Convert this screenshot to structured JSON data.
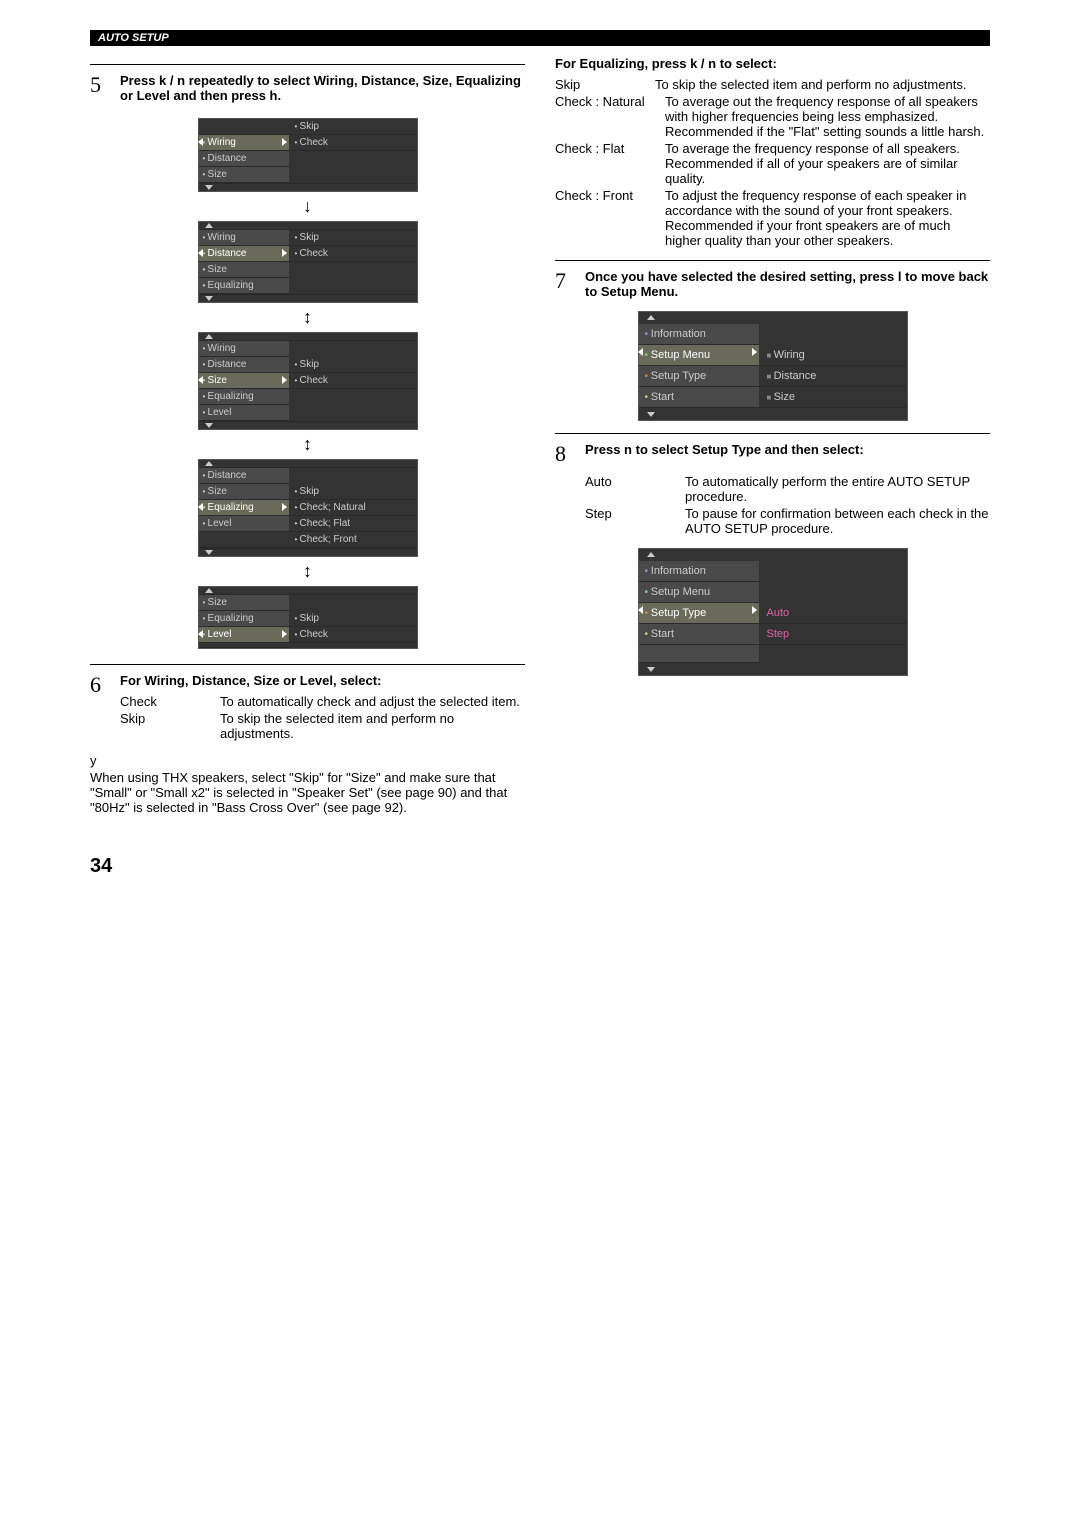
{
  "header": "AUTO SETUP",
  "pageNumber": "34",
  "step5": {
    "num": "5",
    "text_a": "Press ",
    "text_b": " / ",
    "text_c": " repeatedly to select Wiring, Distance, Size, Equalizing or Level and then press ",
    "k": "k",
    "n": "n",
    "h": "h",
    "l": "l",
    "dot": "."
  },
  "menus": {
    "m1": {
      "items": [
        "Wiring",
        "Distance",
        "Size"
      ],
      "sel": 0,
      "opts": [
        "Skip",
        "Check"
      ]
    },
    "m2": {
      "items": [
        "Wiring",
        "Distance",
        "Size",
        "Equalizing"
      ],
      "sel": 1,
      "opts": [
        "Skip",
        "Check"
      ]
    },
    "m3": {
      "items": [
        "Wiring",
        "Distance",
        "Size",
        "Equalizing",
        "Level"
      ],
      "sel": 2,
      "opts": [
        "Skip",
        "Check"
      ]
    },
    "m4": {
      "items": [
        "Distance",
        "Size",
        "Equalizing",
        "Level"
      ],
      "sel": 2,
      "opts": [
        "Skip",
        "Check; Natural",
        "Check; Flat",
        "Check; Front"
      ]
    },
    "m5": {
      "items": [
        "Size",
        "Equalizing",
        "Level"
      ],
      "sel": 2,
      "opts": [
        "Skip",
        "Check"
      ]
    }
  },
  "step6": {
    "num": "6",
    "heading": "For Wiring, Distance, Size or Level, select:",
    "rows": [
      {
        "term": "Check",
        "desc": "To automatically check and adjust the selected item."
      },
      {
        "term": "Skip",
        "desc": "To skip the selected item and perform no adjustments."
      }
    ],
    "noteSymbol": "y",
    "note": "When using THX speakers, select \"Skip\" for \"Size\" and make sure that \"Small\" or \"Small x2\" is selected in \"Speaker Set\" (see page 90) and that \"80Hz\" is selected in \"Bass Cross Over\" (see page 92)."
  },
  "eq": {
    "heading": "For Equalizing, press ",
    "heading_b": " / ",
    "heading_c": " to select:",
    "rows": [
      {
        "term": "Skip",
        "desc": "To skip the selected item and perform no adjustments."
      },
      {
        "term": "Check : Natural",
        "desc": "To average out the frequency response of all speakers with higher frequencies being less emphasized. Recommended if the \"Flat\" setting sounds a little harsh."
      },
      {
        "term": "Check : Flat",
        "desc": "To average the frequency response of all speakers. Recommended if all of your speakers are of similar quality."
      },
      {
        "term": "Check : Front",
        "desc": "To adjust the frequency response of each speaker in accordance with the sound of your front speakers. Recommended if your front speakers are of much higher quality than your other speakers."
      }
    ]
  },
  "step7": {
    "num": "7",
    "text": "Once you have selected the desired setting, press ",
    "text_b": " to move back to Setup Menu.",
    "menu": {
      "left": [
        "Information",
        "Setup Menu",
        "Setup Type",
        "Start"
      ],
      "sel": 1,
      "right": [
        "Wiring",
        "Distance",
        "Size"
      ]
    }
  },
  "step8": {
    "num": "8",
    "heading": "Press ",
    "heading_b": " to select Setup Type and then select:",
    "rows": [
      {
        "term": "Auto",
        "desc": "To automatically perform the entire AUTO SETUP procedure."
      },
      {
        "term": "Step",
        "desc": "To pause for confirmation between each check in the AUTO SETUP procedure."
      }
    ],
    "menu": {
      "left": [
        "Information",
        "Setup Menu",
        "Setup Type",
        "Start"
      ],
      "sel": 2,
      "right": [
        "Auto",
        "Step"
      ]
    }
  }
}
